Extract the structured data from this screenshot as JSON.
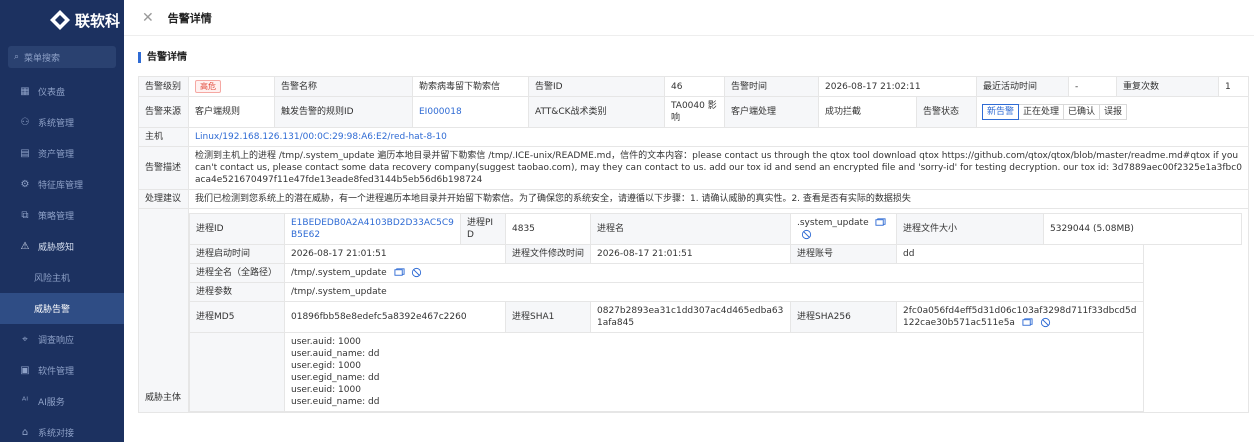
{
  "sidebar": {
    "brand": "联软科",
    "search_label": "菜单搜索",
    "items": [
      {
        "label": "仪表盘"
      },
      {
        "label": "系统管理"
      },
      {
        "label": "资产管理"
      },
      {
        "label": "特征库管理"
      },
      {
        "label": "策略管理"
      },
      {
        "label": "威胁感知"
      },
      {
        "label": "风险主机"
      },
      {
        "label": "威胁告警"
      },
      {
        "label": "调查响应"
      },
      {
        "label": "软件管理"
      },
      {
        "label": "AI服务"
      },
      {
        "label": "系统对接"
      }
    ]
  },
  "drawer": {
    "title": "告警详情",
    "section_title": "告警详情"
  },
  "alert": {
    "level_label": "告警级别",
    "level_value": "高危",
    "name_label": "告警名称",
    "name_value": "勒索病毒留下勒索信",
    "id_label": "告警ID",
    "id_value": "46",
    "time_label": "告警时间",
    "time_value": "2026-08-17 21:02:11",
    "last_active_label": "最近活动时间",
    "last_active_value": "-",
    "repeat_label": "重复次数",
    "repeat_value": "1",
    "source_label": "告警来源",
    "source_value": "客户端规则",
    "rule_id_label": "触发告警的规则ID",
    "rule_id_value": "EI000018",
    "attck_label": "ATT&CK战术类别",
    "attck_value": "TA0040 影响",
    "client_action_label": "客户端处理",
    "client_action_value": "成功拦截",
    "status_label": "告警状态",
    "status_options": [
      "新告警",
      "正在处理",
      "已确认",
      "误报"
    ],
    "host_label": "主机",
    "host_value": "Linux/192.168.126.131/00:0C:29:98:A6:E2/red-hat-8-10",
    "desc_label": "告警描述",
    "desc_value": "检测到主机上的进程 /tmp/.system_update 遍历本地目录并留下勒索信 /tmp/.ICE-unix/README.md，信件的文本内容：please contact us through the qtox tool download qtox https://github.com/qtox/qtox/blob/master/readme.md#qtox if you can't contact us, please contact some data recovery company(suggest taobao.com), may they can contact to us. add our tox id and send an encrypted file and 'sorry-id' for testing decryption. our tox id: 3d7889aec00f2325e1a3fbc0aca4e521670497f11e47fde13eade8fed3144b5eb56d6b198724",
    "advice_label": "处理建议",
    "advice_value": "我们已检测到您系统上的潜在威胁，有一个进程遍历本地目录并开始留下勒索信。为了确保您的系统安全，请遵循以下步骤：1. 请确认威胁的真实性。2. 查看是否有实际的数据损失",
    "subject_label": "威胁主体"
  },
  "process": {
    "id_label": "进程ID",
    "id_value": "E1BEDEDB0A2A4103BD2D33AC5C9B5E62",
    "pid_label": "进程PID",
    "pid_value": "4835",
    "name_label": "进程名",
    "name_value": ".system_update",
    "size_label": "进程文件大小",
    "size_value": "5329044 (5.08MB)",
    "start_label": "进程启动时间",
    "start_value": "2026-08-17 21:01:51",
    "mtime_label": "进程文件修改时间",
    "mtime_value": "2026-08-17 21:01:51",
    "account_label": "进程账号",
    "account_value": "dd",
    "fullname_label": "进程全名（全路径）",
    "fullname_value": "/tmp/.system_update",
    "args_label": "进程参数",
    "args_value": "/tmp/.system_update",
    "md5_label": "进程MD5",
    "md5_value": "01896fbb58e8edefc5a8392e467c2260",
    "sha1_label": "进程SHA1",
    "sha1_value": "0827b2893ea31c1dd307ac4d465edba631afa845",
    "sha256_label": "进程SHA256",
    "sha256_value": "2fc0a056fd4eff5d31d06c103af3298d711f33dbcd5d122cae30b571ac511e5a",
    "user_info": "user.auid: 1000\nuser.auid_name: dd\nuser.egid: 1000\nuser.egid_name: dd\nuser.euid: 1000\nuser.euid_name: dd"
  }
}
